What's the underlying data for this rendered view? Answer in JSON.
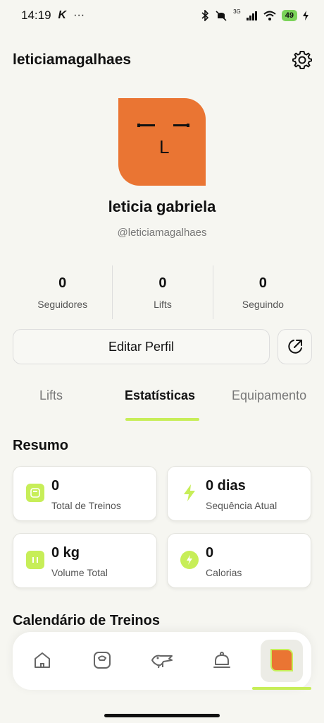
{
  "status_bar": {
    "time": "14:19",
    "extra_icon": "K",
    "dots": "···",
    "network": "3G",
    "battery": "49"
  },
  "header": {
    "username": "leticiamagalhaes",
    "settings_icon": "gear-icon"
  },
  "profile": {
    "display_name": "leticia gabriela",
    "handle": "@leticiamagalhaes",
    "avatar_color": "#ea7533",
    "avatar_letter": "L"
  },
  "stats": [
    {
      "value": "0",
      "label": "Seguidores"
    },
    {
      "value": "0",
      "label": "Lifts"
    },
    {
      "value": "0",
      "label": "Seguindo"
    }
  ],
  "actions": {
    "edit_label": "Editar Perfil",
    "share_icon": "share-icon"
  },
  "tabs": [
    {
      "label": "Lifts",
      "active": false
    },
    {
      "label": "Estatísticas",
      "active": true
    },
    {
      "label": "Equipamento",
      "active": false
    }
  ],
  "summary": {
    "title": "Resumo",
    "cards": [
      {
        "value": "0",
        "label": "Total de Treinos",
        "icon": "scale-icon"
      },
      {
        "value": "0 dias",
        "label": "Sequência Atual",
        "icon": "lightning-icon"
      },
      {
        "value": "0 kg",
        "label": "Volume Total",
        "icon": "weight-icon"
      },
      {
        "value": "0",
        "label": "Calorias",
        "icon": "flame-icon"
      }
    ]
  },
  "calendar": {
    "title": "Calendário de Treinos"
  },
  "nav": [
    {
      "icon": "home-icon"
    },
    {
      "icon": "kettlebell-icon"
    },
    {
      "icon": "crocodile-icon"
    },
    {
      "icon": "bell-icon"
    },
    {
      "icon": "profile-avatar-icon",
      "active": true
    }
  ],
  "colors": {
    "accent": "#c7ee58",
    "avatar": "#ea7533",
    "background": "#f6f6f1"
  }
}
